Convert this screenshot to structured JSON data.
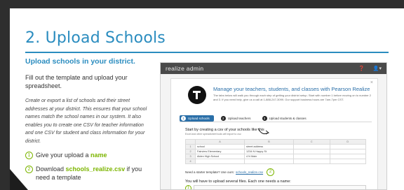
{
  "slide": {
    "title": "2. Upload Schools",
    "subhead": "Upload schools in your district.",
    "intro": "Fill out the template and upload your spreadsheet.",
    "detail": "Create or export a list of schools and their street addresses at your district. This ensures that your school names match the school names in our system. It also enables you to create one CSV for teacher information and one CSV for student and class information for your district.",
    "steps": [
      {
        "num": "1",
        "pre": "Give your upload a ",
        "highlight": "name",
        "post": ""
      },
      {
        "num": "2",
        "pre": "Download ",
        "highlight": "schools_realize.csv",
        "post": " if you need a template"
      }
    ]
  },
  "app": {
    "brand": "realize admin",
    "bar_icons": [
      "help-icon",
      "user-menu-icon"
    ],
    "headline": "Manage your teachers, students, and classes with Pearson Realize",
    "subline": "The tabs below will walk you through each step of getting your district setup. Start with number 1 before moving on to number 2 and 3. If you need help, give us a call at 1-888-247-3099. Our support business hours are 7am-7pm CST.",
    "close": "×",
    "tabs": [
      {
        "num": "1",
        "label": "Upload schools"
      },
      {
        "num": "2",
        "label": "Upload teachers"
      },
      {
        "num": "3",
        "label": "Upload students & classes"
      }
    ],
    "instruction": "Start by creating a csv of your schools like this",
    "instruction_sub": "Excel and other spreadsheet tools will export to csv.",
    "sheet": {
      "columns": [
        "",
        "A",
        "B",
        "C",
        "D"
      ],
      "rows": [
        [
          "1",
          "school",
          "street address",
          "",
          ""
        ],
        [
          "2",
          "Fairview Elementary",
          "1234 N Happy St.",
          "",
          ""
        ],
        [
          "3",
          "Alden High School",
          "4 N Main",
          "",
          ""
        ],
        [
          "4",
          "",
          "",
          "",
          ""
        ]
      ]
    },
    "starter_text": "Need a starter template? Use ours:",
    "starter_link": "schools_realize.csv",
    "starter_badge": "2",
    "upload_text": "You will have to upload several files. Each one needs a name:",
    "name_badge": "1"
  }
}
